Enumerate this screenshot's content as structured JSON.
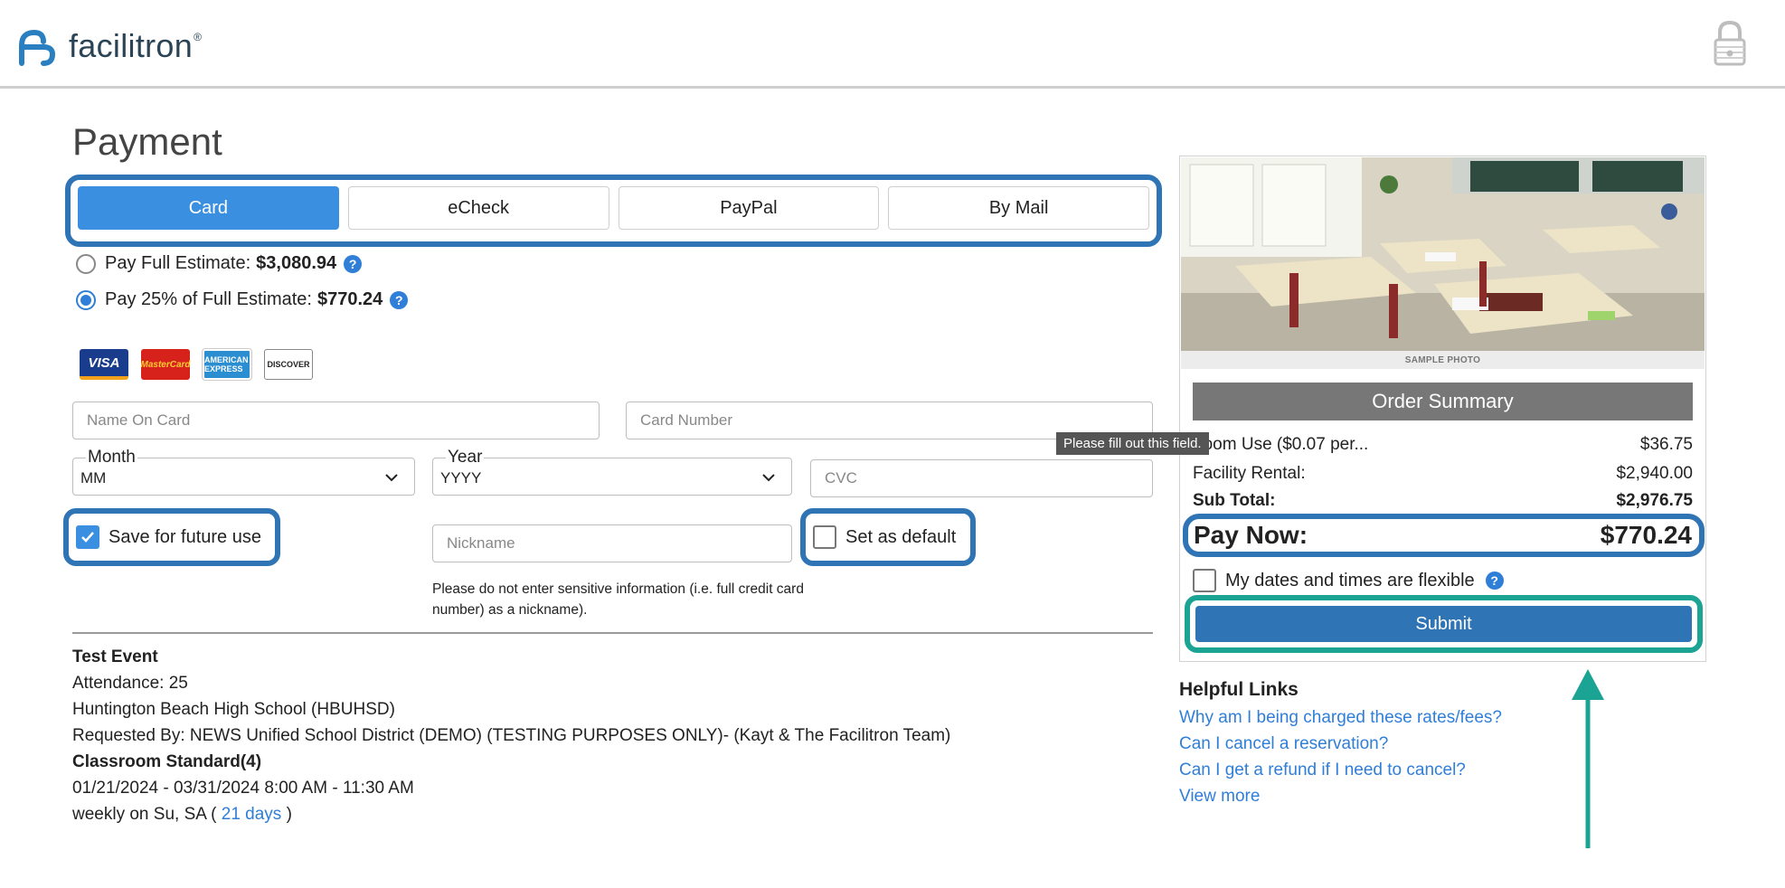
{
  "header": {
    "logo_text": "facilitron",
    "logo_mark": "®"
  },
  "page_title": "Payment",
  "tabs": [
    {
      "label": "Card",
      "active": true
    },
    {
      "label": "eCheck",
      "active": false
    },
    {
      "label": "PayPal",
      "active": false
    },
    {
      "label": "By Mail",
      "active": false
    }
  ],
  "pay_options": {
    "full": {
      "label": "Pay Full Estimate:",
      "amount": "$3,080.94",
      "selected": false
    },
    "partial": {
      "label": "Pay 25% of Full Estimate:",
      "amount": "$770.24",
      "selected": true
    }
  },
  "card_logos": [
    "VISA",
    "MasterCard",
    "AMERICAN EXPRESS",
    "DISCOVER"
  ],
  "form": {
    "name_placeholder": "Name On Card",
    "number_placeholder": "Card Number",
    "month_label": "Month",
    "month_value": "MM",
    "year_label": "Year",
    "year_value": "YYYY",
    "cvc_placeholder": "CVC",
    "save_label": "Save for future use",
    "save_checked": true,
    "nickname_placeholder": "Nickname",
    "default_label": "Set as default",
    "default_checked": false,
    "nickname_note": "Please do not enter sensitive information (i.e. full credit card number) as a nickname)."
  },
  "tooltip": "Please fill out this field.",
  "event": {
    "title": "Test Event",
    "attendance": "Attendance: 25",
    "school": "Huntington Beach High School (HBUHSD)",
    "requested_by": "Requested By: NEWS Unified School District (DEMO) (TESTING PURPOSES ONLY)- (Kayt & The Facilitron Team)",
    "room": "Classroom Standard(4)",
    "dates": "01/21/2024 - 03/31/2024 8:00 AM - 11:30 AM",
    "recurrence_prefix": "weekly on Su, SA (",
    "recurrence_link": "21 days",
    "recurrence_suffix": ")"
  },
  "order_summary": {
    "photo_caption": "SAMPLE PHOTO",
    "title": "Order Summary",
    "rows": [
      {
        "label": "troom Use ($0.07 per...",
        "value": "$36.75"
      },
      {
        "label": "Facility Rental:",
        "value": "$2,940.00"
      }
    ],
    "subtotal_label": "Sub Total:",
    "subtotal_value": "$2,976.75",
    "paynow_label": "Pay Now:",
    "paynow_value": "$770.24",
    "flexible_label": "My dates and times are flexible",
    "submit_label": "Submit"
  },
  "helpful_links": {
    "title": "Helpful Links",
    "links": [
      "Why am I being charged these rates/fees?",
      "Can I cancel a reservation?",
      "Can I get a refund if I need to cancel?",
      "View more"
    ]
  },
  "colors": {
    "accent": "#3b8fe0",
    "outline_blue": "#2f74b5",
    "outline_teal": "#1ba393",
    "link": "#2f7ed8"
  }
}
